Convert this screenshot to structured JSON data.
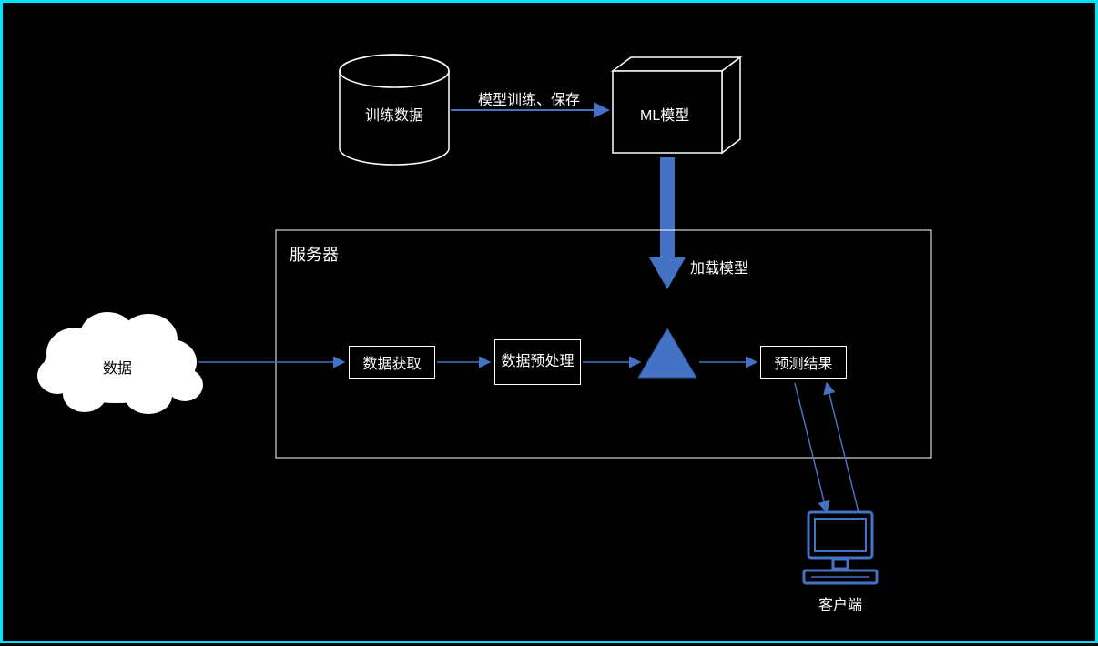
{
  "nodes": {
    "training_data": "训练数据",
    "ml_model": "ML模型",
    "data_cloud": "数据",
    "server_container": "服务器",
    "data_acquire": "数据获取",
    "data_preprocess": "数据预处理",
    "predict_result": "预测结果",
    "client": "客户端"
  },
  "edges": {
    "train_save": "模型训练、保存",
    "load_model": "加载模型"
  },
  "colors": {
    "accent": "#4472c4",
    "cyan_border": "#00e5ff",
    "white": "#ffffff",
    "black": "#000000"
  }
}
